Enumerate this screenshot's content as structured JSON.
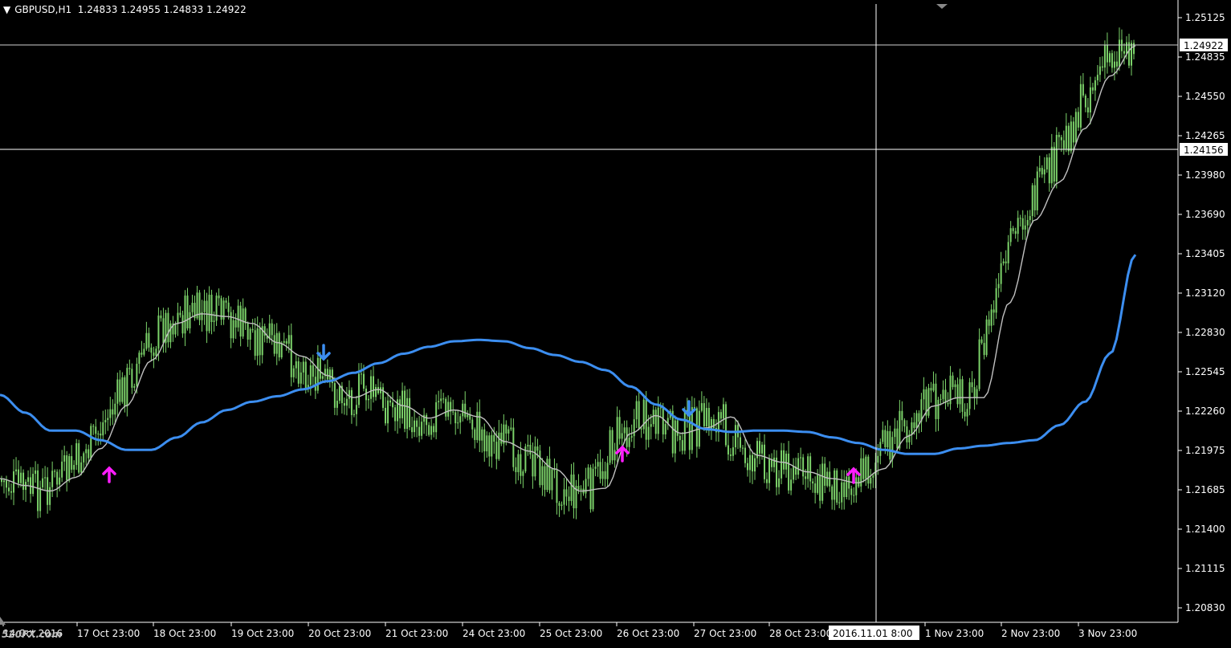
{
  "header": {
    "symbol": "GBPUSD,H1",
    "ohlc": "1.24833 1.24955 1.24833 1.24922"
  },
  "watermark": "520FX.com",
  "price_axis": {
    "labels": [
      "1.25125",
      "1.24835",
      "1.24550",
      "1.24265",
      "1.23980",
      "1.23690",
      "1.23405",
      "1.23120",
      "1.22830",
      "1.22545",
      "1.22260",
      "1.21975",
      "1.21685",
      "1.21400",
      "1.21115",
      "1.20830"
    ],
    "current_price": "1.24922",
    "crosshair_price": "1.24156"
  },
  "time_axis": {
    "labels": [
      "14 Oct 2016",
      "17 Oct 23:00",
      "18 Oct 23:00",
      "19 Oct 23:00",
      "20 Oct 23:00",
      "21 Oct 23:00",
      "24 Oct 23:00",
      "25 Oct 23:00",
      "26 Oct 23:00",
      "27 Oct 23:00",
      "28 Oct 23:00",
      "1 Nov 23:00",
      "2 Nov 23:00",
      "3 Nov 23:00"
    ],
    "crosshair_time": "2016.11.01 8:00"
  },
  "colors": {
    "background": "#000000",
    "candles": "#7cd36a",
    "ma_slow": "#3c8ef0",
    "ma_fast": "#c0c0c0",
    "arrow_up": "#ff1dff",
    "arrow_down": "#3c8ef0",
    "grid_text": "#ffffff"
  },
  "chart_data": {
    "type": "line",
    "title": "GBPUSD,H1",
    "ylim": [
      1.2069,
      1.2527
    ],
    "series": [
      {
        "values": [
          1.2177,
          1.2172,
          1.2168,
          1.2178,
          1.2199,
          1.223,
          1.2263,
          1.229,
          1.2297,
          1.2295,
          1.229,
          1.2276,
          1.2266,
          1.2252,
          1.2236,
          1.2242,
          1.223,
          1.2221,
          1.2227,
          1.2222,
          1.2204,
          1.2197,
          1.2184,
          1.2168,
          1.217,
          1.221,
          1.2223,
          1.221,
          1.2214,
          1.2222,
          1.2194,
          1.2189,
          1.2182,
          1.2177,
          1.2174,
          1.2184,
          1.2208,
          1.223,
          1.2236,
          1.2236,
          1.2305,
          1.2365,
          1.2393,
          1.2432,
          1.247,
          1.2492
        ]
      },
      {
        "values": [
          1.2238,
          1.2225,
          1.2212,
          1.2212,
          1.2205,
          1.2198,
          1.2198,
          1.2207,
          1.2218,
          1.2227,
          1.2233,
          1.2237,
          1.2242,
          1.2248,
          1.2254,
          1.2261,
          1.2268,
          1.2273,
          1.2277,
          1.2278,
          1.2277,
          1.2272,
          1.2267,
          1.2262,
          1.2256,
          1.2244,
          1.2231,
          1.222,
          1.2213,
          1.2211,
          1.2212,
          1.2212,
          1.2211,
          1.2207,
          1.2203,
          1.2198,
          1.2195,
          1.2195,
          1.2199,
          1.2201,
          1.2203,
          1.2205,
          1.2216,
          1.2233,
          1.2268,
          1.234
        ]
      }
    ],
    "signals": [
      {
        "direction": "up"
      },
      {
        "direction": "down"
      },
      {
        "direction": "up"
      },
      {
        "direction": "down"
      },
      {
        "direction": "up"
      }
    ]
  }
}
